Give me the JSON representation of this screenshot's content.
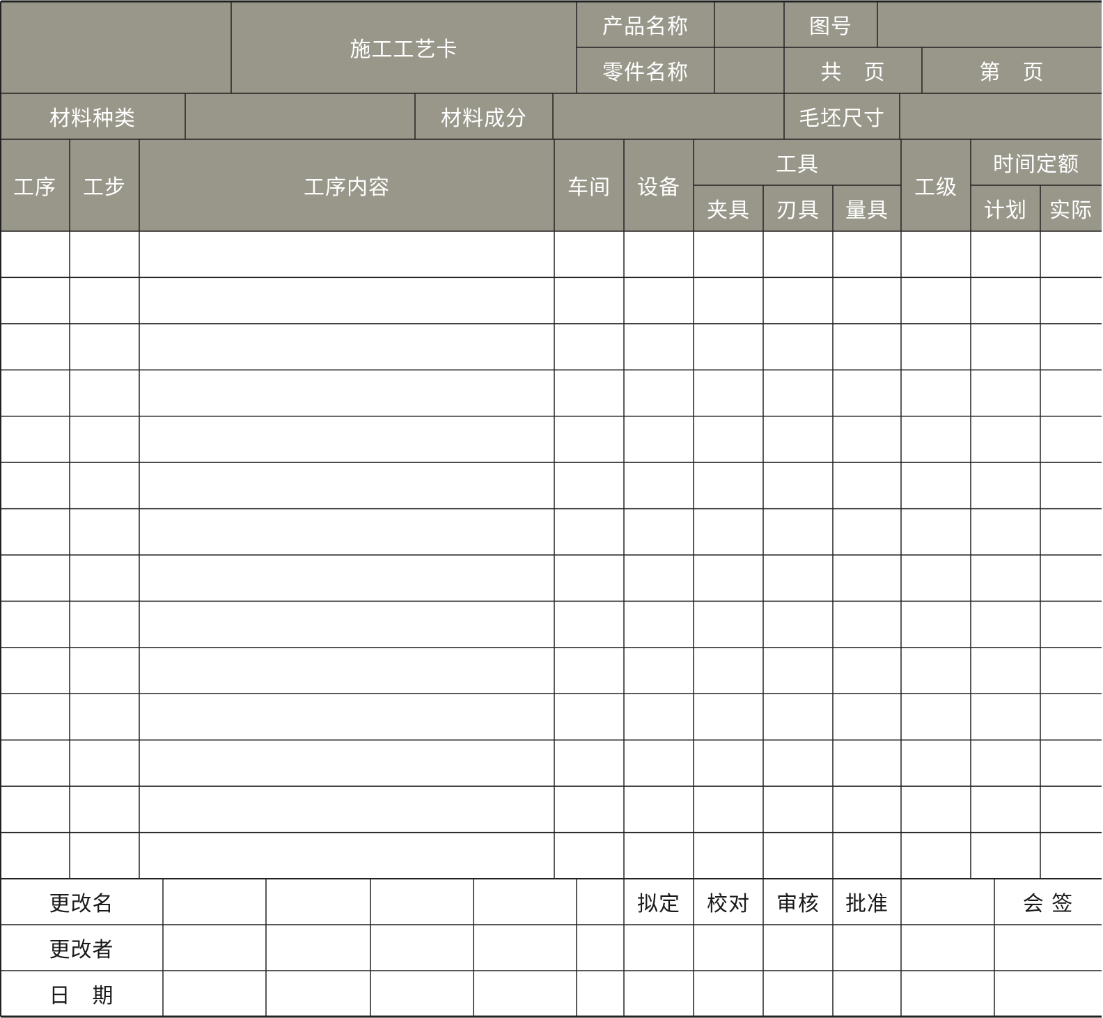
{
  "form": {
    "title": "施工工艺卡",
    "product_name_label": "产品名称",
    "drawing_no_label": "图号",
    "part_name_label": "零件名称",
    "total_pages_label": "共　页",
    "page_no_label": "第　页",
    "material_type_label": "材料种类",
    "material_comp_label": "材料成分",
    "blank_size_label": "毛坯尺寸"
  },
  "table": {
    "columns": {
      "process": "工序",
      "step": "工步",
      "content": "工序内容",
      "workshop": "车间",
      "equipment": "设备",
      "tools": "工具",
      "fixture": "夹具",
      "cutter": "刃具",
      "gauge": "量具",
      "grade": "工级",
      "time_quota": "时间定额",
      "planned": "计划",
      "actual": "实际"
    },
    "row_count": 14
  },
  "footer": {
    "change_name_label": "更改名",
    "changer_label": "更改者",
    "date_label": "日　期",
    "draft_label": "拟定",
    "proofread_label": "校对",
    "review_label": "审核",
    "approve_label": "批准",
    "countersign_label": "会 签"
  },
  "colors": {
    "header_fill": "#98978a",
    "line": "#222222",
    "header_text": "#ffffff"
  }
}
